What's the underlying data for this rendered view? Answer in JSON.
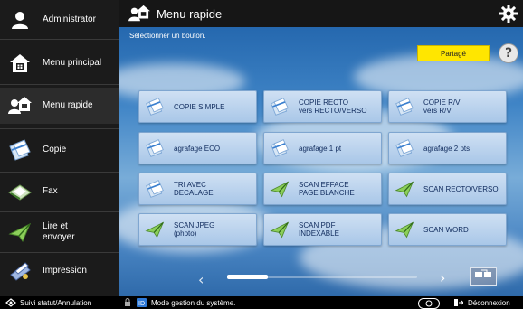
{
  "sidebar": {
    "items": [
      {
        "label": "Administrator",
        "icon": "user-icon"
      },
      {
        "label": "Menu principal",
        "icon": "home-icon"
      },
      {
        "label": "Menu rapide",
        "icon": "quick-menu-icon"
      },
      {
        "label": "Copie",
        "icon": "copy-icon"
      },
      {
        "label": "Fax",
        "icon": "fax-icon"
      },
      {
        "label": "Lire et\nenvoyer",
        "icon": "scan-send-icon"
      },
      {
        "label": "Impression",
        "icon": "print-icon"
      }
    ]
  },
  "header": {
    "title": "Menu rapide",
    "icon": "quick-menu-icon"
  },
  "hint": "Sélectionner un bouton.",
  "shared_button": "Partagé",
  "help_label": "?",
  "tiles": [
    {
      "label": "COPIE SIMPLE",
      "icon": "copy-icon"
    },
    {
      "label": "COPIE RECTO\nvers RECTO/VERSO",
      "icon": "copy-icon"
    },
    {
      "label": "COPIE R/V\nvers R/V",
      "icon": "copy-icon"
    },
    {
      "label": "agrafage ECO",
      "icon": "copy-icon"
    },
    {
      "label": "agrafage 1 pt",
      "icon": "copy-icon"
    },
    {
      "label": "agrafage 2 pts",
      "icon": "copy-icon"
    },
    {
      "label": "TRI AVEC\nDECALAGE",
      "icon": "copy-icon"
    },
    {
      "label": "SCAN EFFACE\nPAGE BLANCHE",
      "icon": "scan-send-icon"
    },
    {
      "label": "SCAN RECTO/VERSO",
      "icon": "scan-send-icon"
    },
    {
      "label": "SCAN JPEG\n(photo)",
      "icon": "scan-send-icon"
    },
    {
      "label": "SCAN PDF\nINDEXABLE",
      "icon": "scan-send-icon"
    },
    {
      "label": "SCAN WORD",
      "icon": "scan-send-icon"
    }
  ],
  "nav": {
    "prev": "‹",
    "next": "›"
  },
  "statusbar": {
    "status_label": "Suivi statut/Annulation",
    "mode_label": "Mode gestion du système.",
    "logout_label": "Déconnexion"
  },
  "colors": {
    "shared_button": "#ffe600",
    "tile": "#bcd4ee",
    "background": "#3f84c6"
  }
}
